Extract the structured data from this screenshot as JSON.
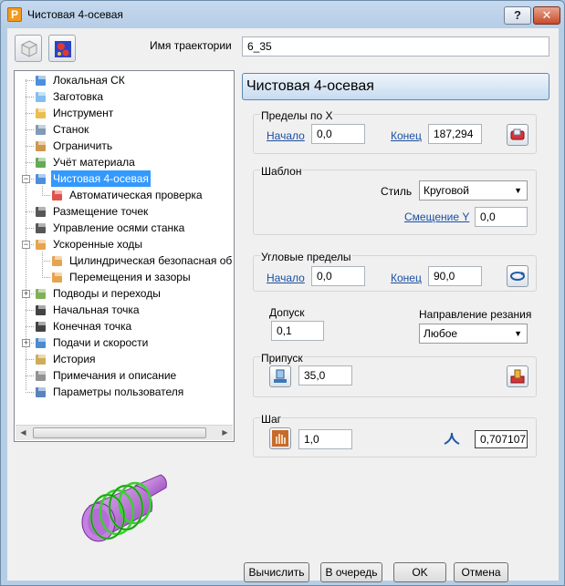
{
  "window": {
    "title": "Чистовая 4-осевая",
    "app_icon_letter": "P",
    "help_label": "?",
    "close_label": "✕"
  },
  "toolbar": {
    "icon1": "cube-group-icon",
    "icon2": "color-map-icon"
  },
  "name": {
    "label": "Имя траектории",
    "value": "6_35"
  },
  "tree": {
    "items": [
      {
        "label": "Локальная СК",
        "icon": "coordinate-system-icon"
      },
      {
        "label": "Заготовка",
        "icon": "stock-block-icon"
      },
      {
        "label": "Инструмент",
        "icon": "tool-icon"
      },
      {
        "label": "Станок",
        "icon": "machine-icon"
      },
      {
        "label": "Ограничить",
        "icon": "limit-icon"
      },
      {
        "label": "Учёт материала",
        "icon": "rest-material-icon"
      },
      {
        "label": "Чистовая 4-осевая",
        "icon": "finishing-4axis-icon"
      },
      {
        "label": "Автоматическая проверка",
        "icon": "auto-check-icon"
      },
      {
        "label": "Размещение точек",
        "icon": "point-distribution-icon"
      },
      {
        "label": "Управление осями станка",
        "icon": "axis-control-icon"
      },
      {
        "label": "Ускоренные ходы",
        "icon": "rapid-moves-icon"
      },
      {
        "label": "Цилиндрическая безопасная об",
        "icon": "safe-area-icon"
      },
      {
        "label": "Перемещения и зазоры",
        "icon": "moves-clearances-icon"
      },
      {
        "label": "Подводы и переходы",
        "icon": "leads-links-icon"
      },
      {
        "label": "Начальная точка",
        "icon": "start-point-icon"
      },
      {
        "label": "Конечная точка",
        "icon": "end-point-icon"
      },
      {
        "label": "Подачи и скорости",
        "icon": "feeds-speeds-icon"
      },
      {
        "label": "История",
        "icon": "history-icon"
      },
      {
        "label": "Примечания и описание",
        "icon": "notes-icon"
      },
      {
        "label": "Параметры пользователя",
        "icon": "user-params-icon"
      }
    ]
  },
  "page": {
    "header": "Чистовая 4-осевая",
    "x_limits": {
      "title": "Пределы по X",
      "start_label": "Начало",
      "start_value": "0,0",
      "end_label": "Конец",
      "end_value": "187,294",
      "button_icon": "measure-limits-icon"
    },
    "pattern": {
      "title": "Шаблон",
      "style_label": "Стиль",
      "style_value": "Круговой",
      "offset_label": "Смещение Y",
      "offset_value": "0,0"
    },
    "angle_limits": {
      "title": "Угловые пределы",
      "start_label": "Начало",
      "start_value": "0,0",
      "end_label": "Конец",
      "end_value": "90,0",
      "button_icon": "angle-limits-icon"
    },
    "tolerance": {
      "title": "Допуск",
      "value": "0,1"
    },
    "cut_direction": {
      "title": "Направление резания",
      "value": "Любое"
    },
    "thickness": {
      "title": "Припуск",
      "value": "35,0",
      "icon": "thickness-icon",
      "button_icon": "component-thickness-icon"
    },
    "stepover": {
      "title": "Шаг",
      "value": "1,0",
      "cusp_value": "0,707107",
      "icon": "stepover-hand-icon",
      "cusp_icon": "cusp-icon"
    }
  },
  "buttons": {
    "calculate": "Вычислить",
    "queue": "В очередь",
    "ok": "OK",
    "cancel": "Отмена"
  },
  "colors": {
    "selection": "#3399ff",
    "link": "#1a4fa3",
    "title_bar": "#b6cde6",
    "preview_coil": "#39d12f",
    "preview_body": "#b56cd6"
  }
}
